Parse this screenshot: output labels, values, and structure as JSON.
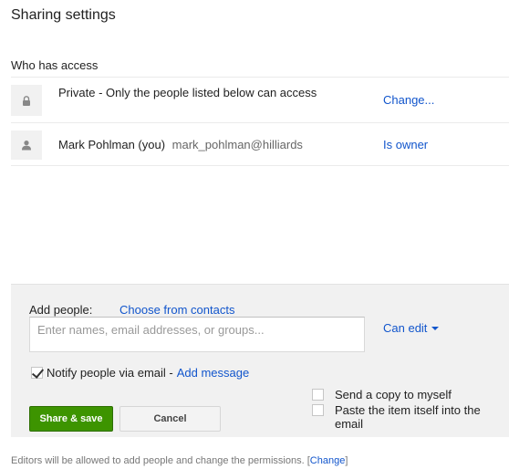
{
  "dialog": {
    "title": "Sharing settings"
  },
  "access": {
    "section_label": "Who has access",
    "rows": [
      {
        "icon": "lock-icon",
        "text": "Private - Only the people listed below can access",
        "action": "Change..."
      },
      {
        "icon": "person-icon",
        "name": "Mark Pohlman (you)",
        "email": "mark_pohlman@hilliards",
        "role": "Is owner"
      }
    ]
  },
  "add_people": {
    "label": "Add people:",
    "contacts_link": "Choose from contacts",
    "input_placeholder": "Enter names, email addresses, or groups...",
    "permission": "Can edit",
    "notify": {
      "label": "Notify people via email -",
      "checked": true,
      "add_message": "Add message"
    },
    "options": [
      {
        "label": "Send a copy to myself",
        "checked": false
      },
      {
        "label": "Paste the item itself into the email",
        "checked": false
      }
    ],
    "share_button": "Share & save",
    "cancel_button": "Cancel"
  },
  "footer": {
    "note": "Editors will be allowed to add people and change the permissions.",
    "bracket_open": "[",
    "change_link": "Change",
    "bracket_close": "]"
  },
  "colors": {
    "link": "#1155cc",
    "share_button": "#3d9400",
    "panel_bg": "#f1f1f1"
  }
}
